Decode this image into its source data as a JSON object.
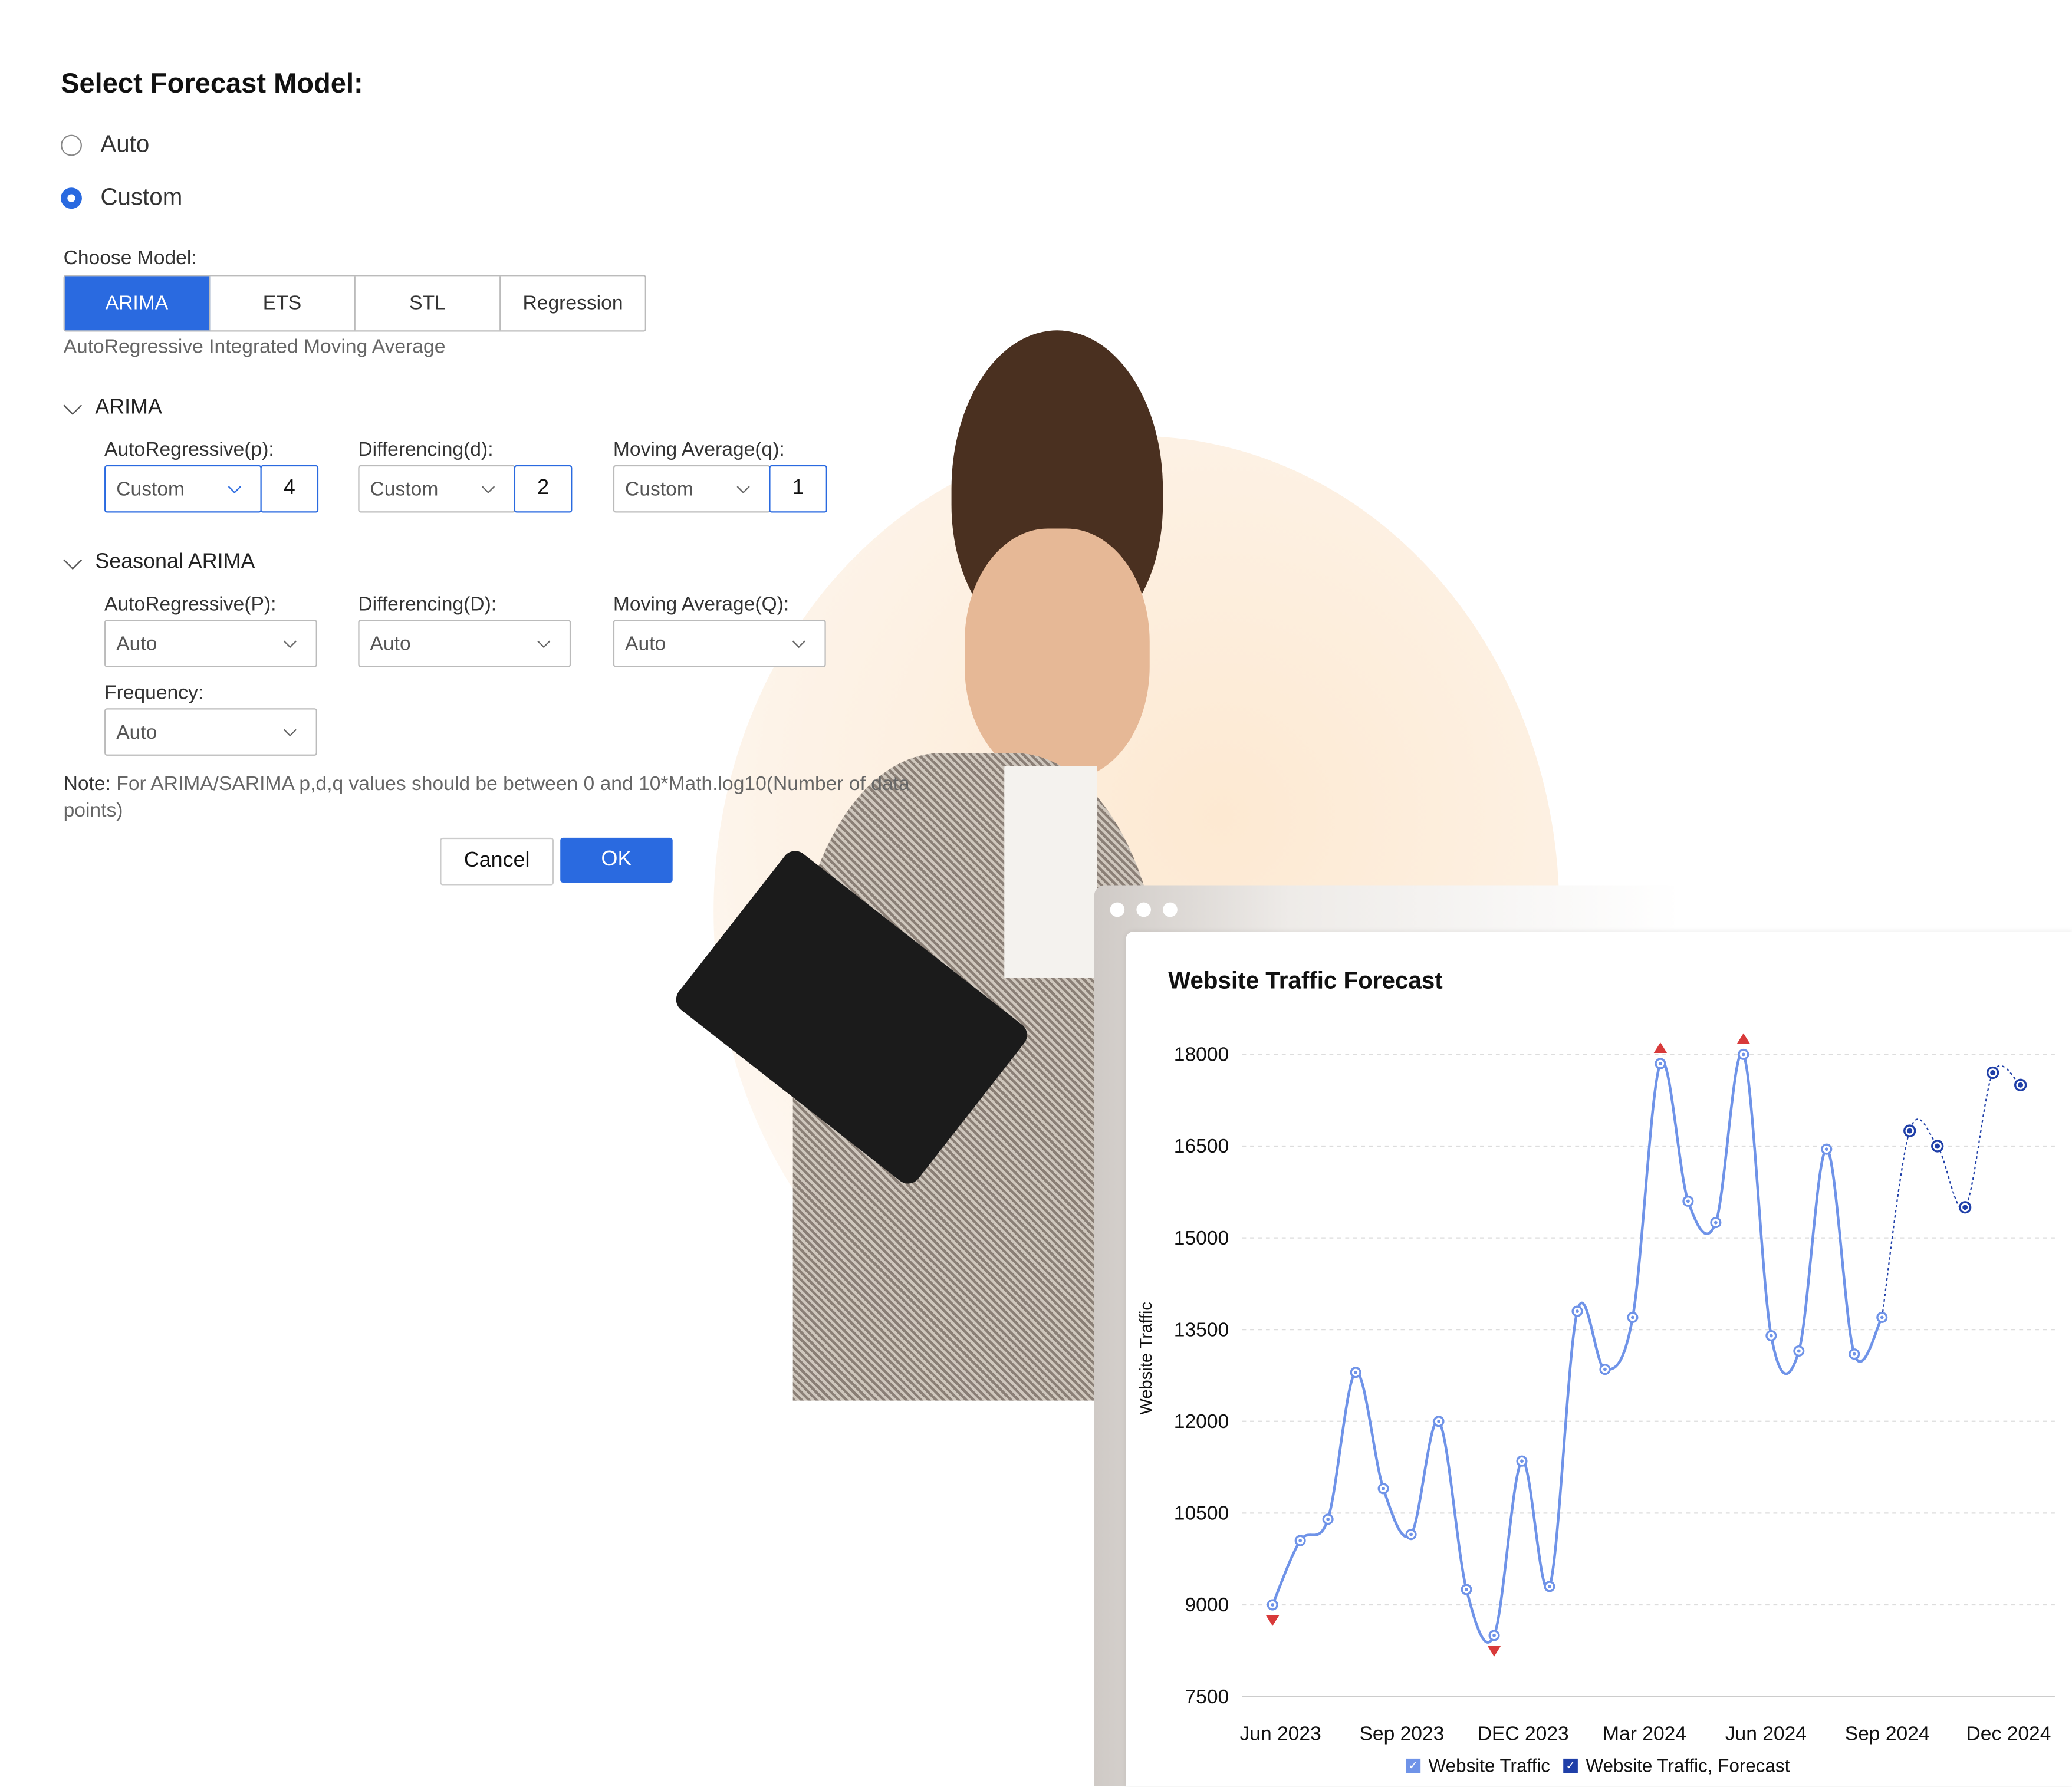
{
  "dialog": {
    "title": "Select Forecast Model:",
    "radios": [
      {
        "label": "Auto",
        "selected": false
      },
      {
        "label": "Custom",
        "selected": true
      }
    ],
    "choose_model_label": "Choose Model:",
    "models": [
      "ARIMA",
      "ETS",
      "STL",
      "Regression"
    ],
    "selected_model": "ARIMA",
    "model_description": "AutoRegressive Integrated Moving Average",
    "arima": {
      "title": "ARIMA",
      "fields": [
        {
          "label": "AutoRegressive(p):",
          "mode": "Custom",
          "value": "4"
        },
        {
          "label": "Differencing(d):",
          "mode": "Custom",
          "value": "2"
        },
        {
          "label": "Moving Average(q):",
          "mode": "Custom",
          "value": "1"
        }
      ]
    },
    "seasonal": {
      "title": "Seasonal ARIMA",
      "fields": [
        {
          "label": "AutoRegressive(P):",
          "value": "Auto"
        },
        {
          "label": "Differencing(D):",
          "value": "Auto"
        },
        {
          "label": "Moving Average(Q):",
          "value": "Auto"
        }
      ],
      "frequency_label": "Frequency:",
      "frequency_value": "Auto"
    },
    "note_prefix": "Note:",
    "note_text": "For ARIMA/SARIMA p,d,q values should be between 0 and 10*Math.log10(Number of data points)",
    "cancel": "Cancel",
    "ok": "OK",
    "accent": "#2a6ae0"
  },
  "chart_data": {
    "type": "line",
    "title": "Website Traffic Forecast",
    "ylabel": "Website Traffic",
    "xlabel": "",
    "ylim": [
      7500,
      18000
    ],
    "yticks": [
      18000,
      16500,
      15000,
      13500,
      12000,
      10500,
      9000,
      7500
    ],
    "xticks": [
      "Jun 2023",
      "Sep 2023",
      "DEC 2023",
      "Mar 2024",
      "Jun 2024",
      "Sep 2024",
      "Dec 2024"
    ],
    "grid": true,
    "legend_position": "bottom",
    "series": [
      {
        "name": "Website Traffic",
        "color": "#6f93e8",
        "values": [
          9000,
          10050,
          10400,
          12800,
          10900,
          10150,
          12000,
          9250,
          8500,
          11350,
          9300,
          13800,
          12850,
          13700,
          17850,
          15600,
          15250,
          18000,
          13400,
          13150,
          16450,
          13100,
          13700
        ]
      },
      {
        "name": "Website Traffic, Forecast",
        "color": "#1f3fa8",
        "values": [
          16750,
          16500,
          15500,
          17700,
          17500
        ]
      }
    ],
    "anomalies": [
      {
        "index": 0,
        "type": "low"
      },
      {
        "index": 8,
        "type": "low"
      },
      {
        "index": 14,
        "type": "high"
      },
      {
        "index": 17,
        "type": "high"
      }
    ],
    "anomaly_color": "#d83a3a"
  }
}
